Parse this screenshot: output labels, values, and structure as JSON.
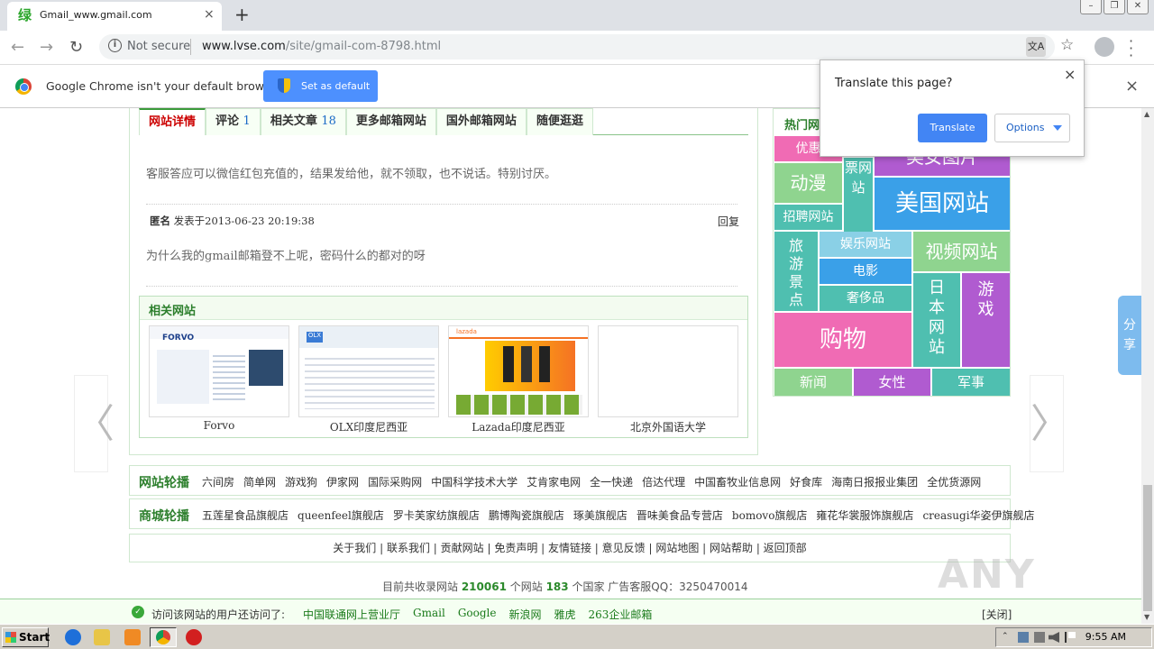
{
  "browser": {
    "tab_favicon": "绿",
    "tab_title": "Gmail_www.gmail.com",
    "tab_close": "×",
    "new_tab": "+",
    "not_secure": "Not secure",
    "url_host": "www.lvse.com",
    "url_path": "/site/gmail-com-8798.html",
    "window_buttons": [
      "–",
      "❐",
      "✕"
    ]
  },
  "infobar": {
    "message": "Google Chrome isn't your default browser",
    "button": "Set as default",
    "close": "×"
  },
  "translate_popup": {
    "title": "Translate this page?",
    "translate_button": "Translate",
    "options_button": "Options",
    "close": "×"
  },
  "page": {
    "tabs": [
      {
        "label": "网站详情",
        "num": ""
      },
      {
        "label": "评论 ",
        "num": "1"
      },
      {
        "label": "相关文章 ",
        "num": "18"
      },
      {
        "label": "更多邮箱网站",
        "num": ""
      },
      {
        "label": "国外邮箱网站",
        "num": ""
      },
      {
        "label": "随便逛逛",
        "num": ""
      }
    ],
    "comment1_text": "客服答应可以微信红包充值的，结果发给他，就不领取，也不说话。特别讨厌。",
    "comment2_author": "匿名",
    "comment2_meta": " 发表于2013-06-23 20:19:38",
    "comment2_reply": "回复",
    "comment2_text": "为什么我的gmail邮箱登不上呢，密码什么的都对的呀",
    "related_title": "相关网站",
    "related_sites": [
      "Forvo",
      "OLX印度尼西亚",
      "Lazada印度尼西亚",
      "北京外国语大学"
    ],
    "hot_title": "热门网",
    "hot_tiles": [
      "优惠",
      "票网站",
      "美女图片",
      "动漫",
      "美国网站",
      "招聘网站",
      "旅游景点",
      "娱乐网站",
      "视频网站",
      "电影",
      "奢侈品",
      "日本网站",
      "游戏",
      "购物",
      "新闻",
      "女性",
      "军事"
    ],
    "share": "分享",
    "prev_arrow": "〈",
    "next_arrow": "〉",
    "rotation_head": "网站轮播",
    "rotation_links": [
      "六间房",
      "简单网",
      "游戏狗",
      "伊家网",
      "国际采购网",
      "中国科学技术大学",
      "艾肯家电网",
      "全一快递",
      "倍达代理",
      "中国畜牧业信息网",
      "好食库",
      "海南日报报业集团",
      "全优货源网"
    ],
    "mall_head": "商城轮播",
    "mall_links": [
      "五莲星食品旗舰店",
      "queenfeel旗舰店",
      "罗卡芙家纺旗舰店",
      "鹏博陶瓷旗舰店",
      "琢美旗舰店",
      "晋味美食品专营店",
      "bomovo旗舰店",
      "雍花华裳服饰旗舰店",
      "creasugi华姿伊旗舰店"
    ],
    "footer_links": "关于我们 | 联系我们 | 贡献网站 | 免责声明 | 友情链接 | 意见反馈 | 网站地图 | 网站帮助 | 返回顶部",
    "stats_prefix": "目前共收录网站 ",
    "stats_sites": "210061",
    "stats_mid": " 个网站 ",
    "stats_countries": "183",
    "stats_suffix": " 个国家 广告客服QQ：3250470014",
    "bottom_label": "访问该网站的用户还访问了:",
    "bottom_links": [
      "中国联通网上营业厅",
      "Gmail",
      "Google",
      "新浪网",
      "雅虎",
      "263企业邮箱"
    ],
    "bottom_close": "[关闭]",
    "watermark": "ANY RUN"
  },
  "taskbar": {
    "start": "Start",
    "clock": "9:55 AM"
  },
  "colors": {
    "green_head": "#2c7f2c",
    "pink": "#f06bb4",
    "purple": "#b05bd0",
    "teal": "#4fbfb0",
    "light_green": "#8fd48f",
    "blue": "#3aa0e8"
  }
}
